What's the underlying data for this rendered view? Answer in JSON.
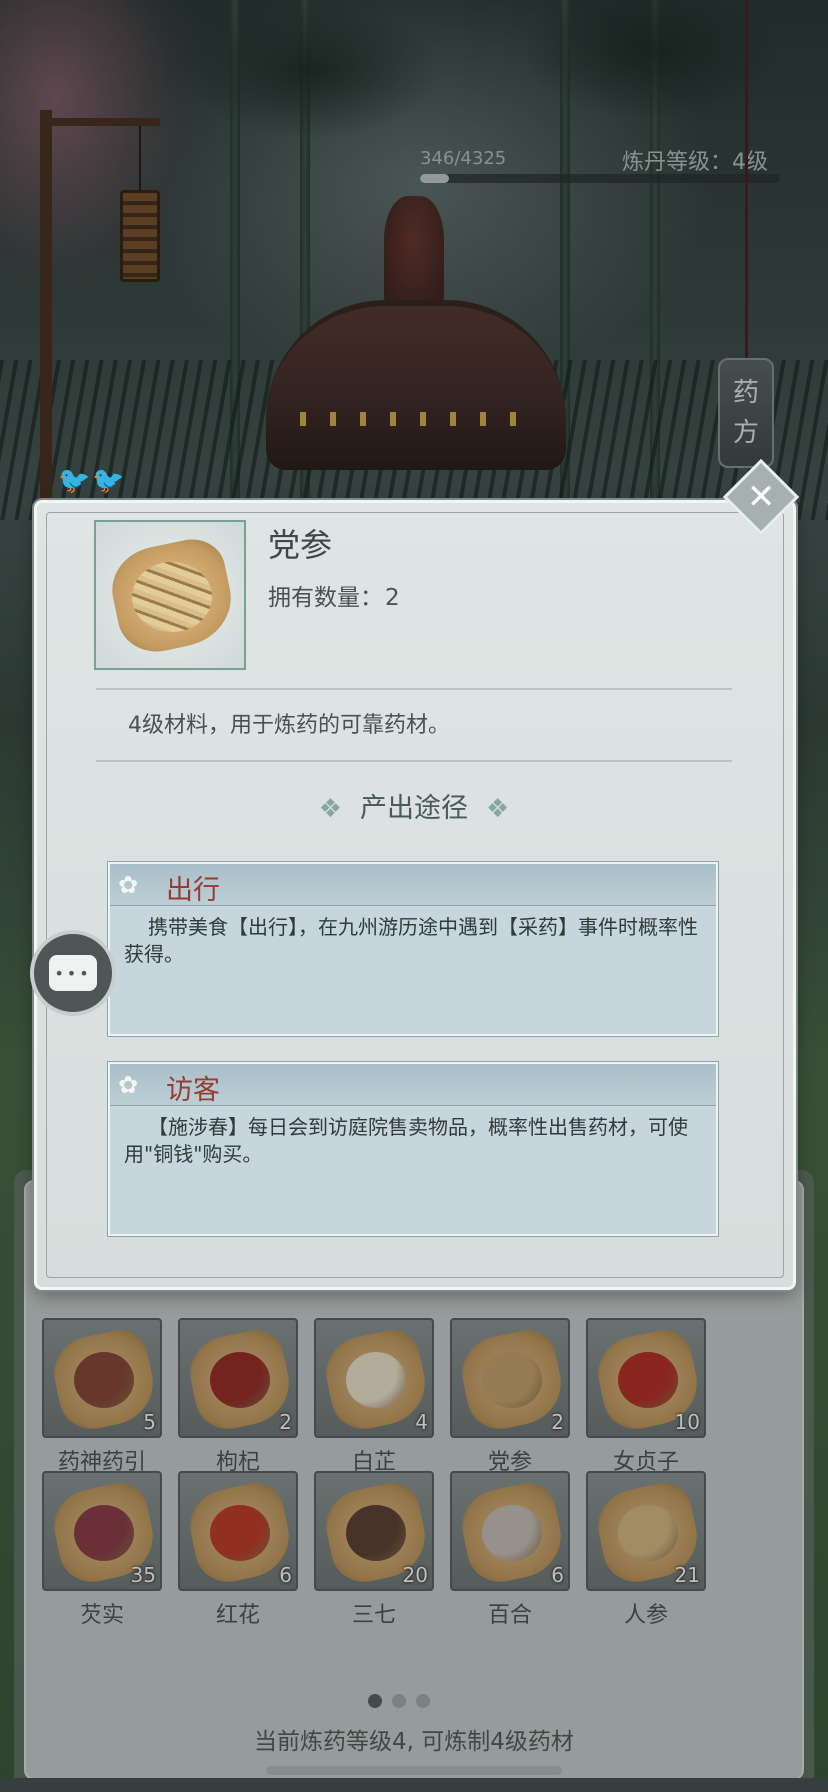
{
  "hud": {
    "progress_text": "346/4325",
    "progress_fraction": 0.08,
    "level_text": "炼丹等级：4级"
  },
  "recipe_button": {
    "line1": "药",
    "line2": "方"
  },
  "popup": {
    "item_name": "党参",
    "count_label": "拥有数量：",
    "count_value": "2",
    "description": "4级材料，用于炼药的可靠药材。",
    "section_title": "产出途径",
    "close_icon": "✕",
    "sources": [
      {
        "title": "出行",
        "text": "携带美食【出行】，在九州游历途中遇到【采药】事件时概率性获得。"
      },
      {
        "title": "访客",
        "text": "【施涉春】每日会到访庭院售卖物品，概率性出售药材，可使用\"铜钱\"购买。"
      }
    ]
  },
  "inventory": {
    "items": [
      {
        "name": "药神药引",
        "qty": "5",
        "herb_color": "#8a4a3a"
      },
      {
        "name": "枸杞",
        "qty": "2",
        "herb_color": "#9c2f2a"
      },
      {
        "name": "白芷",
        "qty": "4",
        "herb_color": "#efe6d2"
      },
      {
        "name": "党参",
        "qty": "2",
        "herb_color": "#c9a66e"
      },
      {
        "name": "女贞子",
        "qty": "10",
        "herb_color": "#b8322a"
      },
      {
        "name": "芡实",
        "qty": "35",
        "herb_color": "#8e3f4a"
      },
      {
        "name": "红花",
        "qty": "6",
        "herb_color": "#c2402c"
      },
      {
        "name": "三七",
        "qty": "20",
        "herb_color": "#5e4438"
      },
      {
        "name": "百合",
        "qty": "6",
        "herb_color": "#c8c2bb"
      },
      {
        "name": "人参",
        "qty": "21",
        "herb_color": "#d8bb86"
      }
    ],
    "page_count": 3,
    "active_page": 1
  },
  "footer": {
    "status_text": "当前炼药等级4, 可炼制4级药材"
  },
  "colors": {
    "accent_red": "#9a3a32",
    "panel": "#dfe5e4",
    "card": "#c6d6dc"
  }
}
